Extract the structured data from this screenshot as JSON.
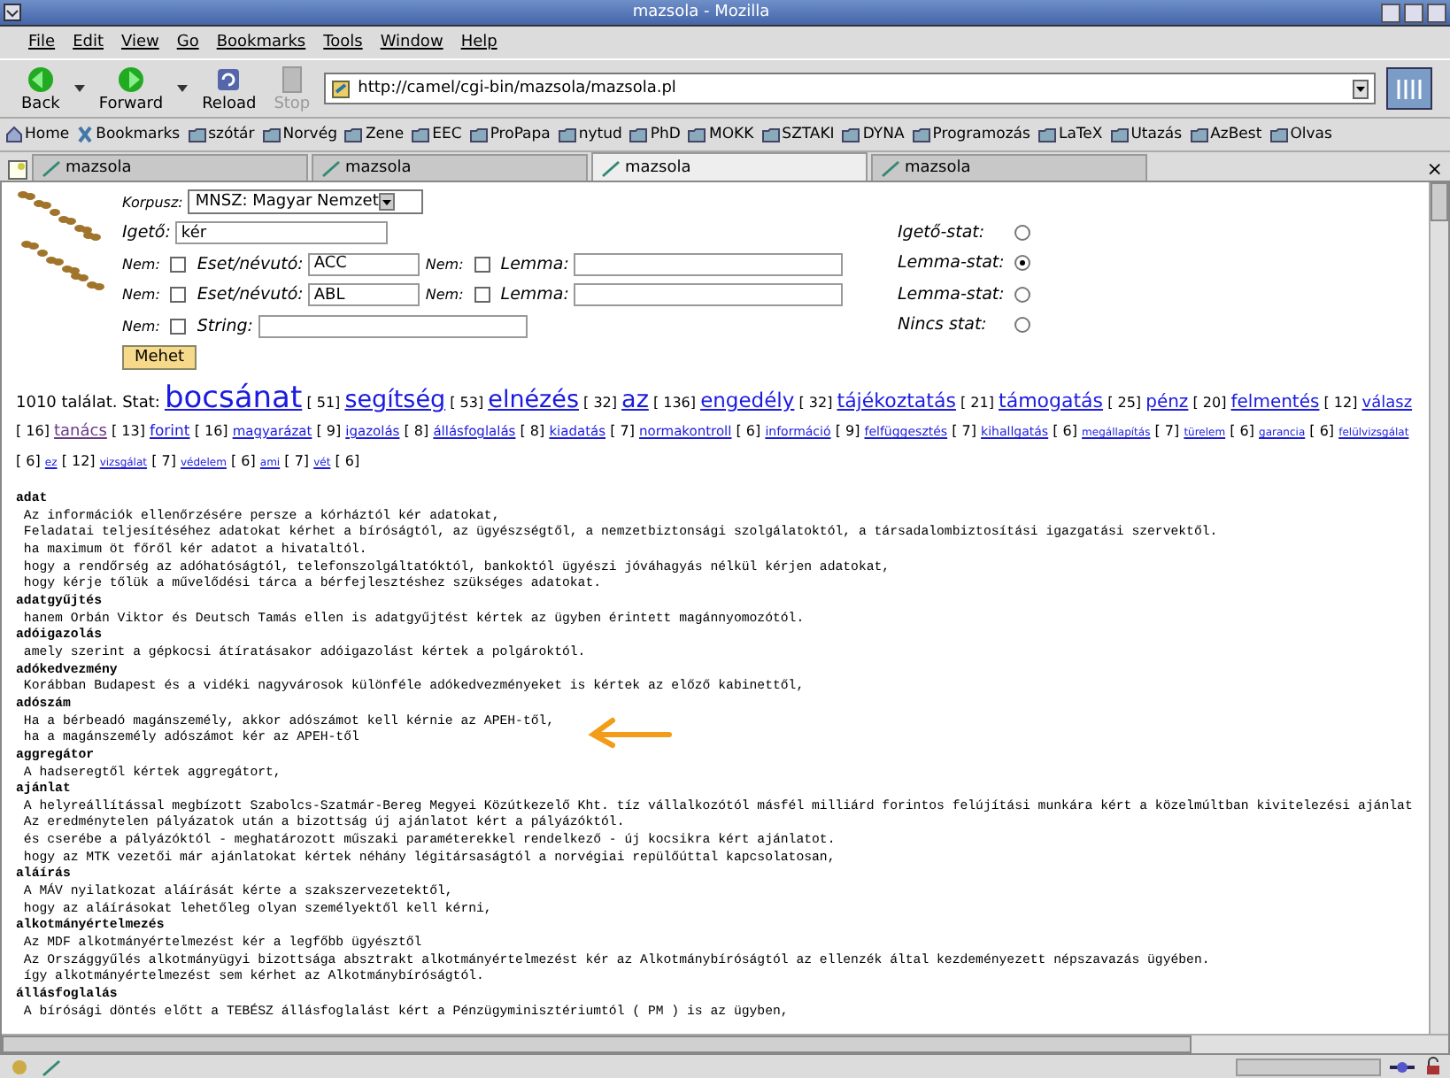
{
  "window": {
    "title": "mazsola - Mozilla"
  },
  "menu": [
    "File",
    "Edit",
    "View",
    "Go",
    "Bookmarks",
    "Tools",
    "Window",
    "Help"
  ],
  "nav_buttons": [
    {
      "kind": "back",
      "label": "Back",
      "disabled": false
    },
    {
      "kind": "forward",
      "label": "Forward",
      "disabled": false
    },
    {
      "kind": "reload",
      "label": "Reload",
      "disabled": false
    },
    {
      "kind": "stop",
      "label": "Stop",
      "disabled": true
    }
  ],
  "address": "http://camel/cgi-bin/mazsola/mazsola.pl",
  "bookmarks": [
    {
      "kind": "home",
      "label": "Home"
    },
    {
      "kind": "bookmarks",
      "label": "Bookmarks"
    },
    {
      "kind": "folder",
      "label": "szótár"
    },
    {
      "kind": "folder",
      "label": "Norvég"
    },
    {
      "kind": "folder",
      "label": "Zene"
    },
    {
      "kind": "folder",
      "label": "EEC"
    },
    {
      "kind": "folder",
      "label": "ProPapa"
    },
    {
      "kind": "folder",
      "label": "nytud"
    },
    {
      "kind": "folder",
      "label": "PhD"
    },
    {
      "kind": "folder",
      "label": "MOKK"
    },
    {
      "kind": "folder",
      "label": "SZTAKI"
    },
    {
      "kind": "folder",
      "label": "DYNA"
    },
    {
      "kind": "folder",
      "label": "Programozás"
    },
    {
      "kind": "folder",
      "label": "LaTeX"
    },
    {
      "kind": "folder",
      "label": "Utazás"
    },
    {
      "kind": "folder",
      "label": "AzBest"
    },
    {
      "kind": "folder",
      "label": "Olvas"
    }
  ],
  "tabs": [
    {
      "label": "mazsola",
      "selected": false
    },
    {
      "label": "mazsola",
      "selected": false
    },
    {
      "label": "mazsola",
      "selected": true
    },
    {
      "label": "mazsola",
      "selected": false
    }
  ],
  "close_tab": "×",
  "form": {
    "corpus": {
      "label": "Korpusz:",
      "value": "MNSZ: Magyar Nemzet"
    },
    "verb": {
      "label": "Igető:",
      "value": "kér"
    },
    "filters": [
      {
        "neg_label": "Nem:",
        "negated": false,
        "label": "Eset/névutó:",
        "value": "ACC",
        "lemma_neg_label": "Nem:",
        "lemma_negated": false,
        "lemma_label": "Lemma:"
      },
      {
        "neg_label": "Nem:",
        "negated": false,
        "label": "Eset/névutó:",
        "value": "ABL",
        "lemma_neg_label": "Nem:",
        "lemma_negated": false,
        "lemma_label": "Lemma:"
      }
    ],
    "string": {
      "neg_label": "Nem:",
      "negated": false,
      "label": "String:"
    },
    "stats": [
      {
        "label": "Igető-stat:",
        "selected": false
      },
      {
        "label": "Lemma-stat:",
        "selected": true
      },
      {
        "label": "Lemma-stat:",
        "selected": false
      },
      {
        "label": "Nincs stat:",
        "selected": false
      }
    ],
    "submit": "Mehet"
  },
  "results": {
    "summary": "1010 találat. Stat:",
    "stats": [
      {
        "word": "bocsánat",
        "count": "[ 51]",
        "visited": false
      },
      {
        "word": "segítség",
        "count": "[ 53]",
        "visited": false
      },
      {
        "word": "elnézés",
        "count": "[ 32]",
        "visited": false
      },
      {
        "word": "az",
        "count": "[ 136]",
        "visited": false
      },
      {
        "word": "engedély",
        "count": "[ 32]",
        "visited": false
      },
      {
        "word": "tájékoztatás",
        "count": "[ 21]",
        "visited": false
      },
      {
        "word": "támogatás",
        "count": "[ 25]",
        "visited": false
      },
      {
        "word": "pénz",
        "count": "[ 20]",
        "visited": false
      },
      {
        "word": "felmentés",
        "count": "[ 12]",
        "visited": false
      },
      {
        "word": "válasz",
        "count": "[ 16]",
        "visited": false
      },
      {
        "word": "tanács",
        "count": "[ 13]",
        "visited": true
      },
      {
        "word": "forint",
        "count": "[ 16]",
        "visited": false
      },
      {
        "word": "magyarázat",
        "count": "[ 9]",
        "visited": false
      },
      {
        "word": "igazolás",
        "count": "[ 8]",
        "visited": false
      },
      {
        "word": "állásfoglalás",
        "count": "[ 8]",
        "visited": false
      },
      {
        "word": "kiadatás",
        "count": "[ 7]",
        "visited": false
      },
      {
        "word": "normakontroll",
        "count": "[ 6]",
        "visited": false
      },
      {
        "word": "információ",
        "count": "[ 9]",
        "visited": false
      },
      {
        "word": "felfüggesztés",
        "count": "[ 7]",
        "visited": false
      },
      {
        "word": "kihallgatás",
        "count": "[ 6]",
        "visited": false
      },
      {
        "word": "megállapítás",
        "count": "[ 7]",
        "visited": false
      },
      {
        "word": "türelem",
        "count": "[ 6]",
        "visited": false
      },
      {
        "word": "garancia",
        "count": "[ 6]",
        "visited": false
      },
      {
        "word": "felülvizsgálat",
        "count": "[ 6]",
        "visited": false
      },
      {
        "word": "ez",
        "count": "[ 12]",
        "visited": false
      },
      {
        "word": "vizsgálat",
        "count": "[ 7]",
        "visited": false
      },
      {
        "word": "védelem",
        "count": "[ 6]",
        "visited": false
      },
      {
        "word": "ami",
        "count": "[ 7]",
        "visited": false
      },
      {
        "word": "vét",
        "count": "[ 6]",
        "visited": false
      }
    ],
    "entries": [
      {
        "head": "adat",
        "lines": [
          "Az információk ellenőrzésére persze a kórháztól kér adatokat,",
          "Feladatai teljesítéséhez adatokat kérhet a bíróságtól, az ügyészségtől, a nemzetbiztonsági szolgálatoktól, a társadalombiztosítási igazgatási szervektől.",
          "ha maximum öt főről kér adatot a hivataltól.",
          "hogy a rendőrség az adóhatóságtól, telefonszolgáltatóktól, bankoktól ügyészi jóváhagyás nélkül kérjen adatokat,",
          "hogy kérje tőlük a művelődési tárca a bérfejlesztéshez szükséges adatokat."
        ]
      },
      {
        "head": "adatgyűjtés",
        "lines": [
          "hanem Orbán Viktor és Deutsch Tamás ellen is adatgyűjtést kértek az ügyben érintett magánnyomozótól."
        ]
      },
      {
        "head": "adóigazolás",
        "lines": [
          "amely szerint a gépkocsi átíratásakor adóigazolást kértek a polgároktól."
        ]
      },
      {
        "head": "adókedvezmény",
        "lines": [
          "Korábban Budapest és a vidéki nagyvárosok különféle adókedvezményeket is kértek az előző kabinettől,"
        ]
      },
      {
        "head": "adószám",
        "lines": [
          "Ha a bérbeadó magánszemély, akkor adószámot kell kérnie az APEH-től,",
          "ha a magánszemély adószámot kér az APEH-től"
        ]
      },
      {
        "head": "aggregátor",
        "lines": [
          "A hadseregtől kértek aggregátort,"
        ]
      },
      {
        "head": "ajánlat",
        "lines": [
          "A helyreállítással megbízott Szabolcs-Szatmár-Bereg Megyei Közútkezelő Kht. tíz vállalkozótól másfél milliárd forintos felújítási munkára kért a közelmúltban kivitelezési ajánlat",
          "Az eredménytelen pályázatok után a bizottság új ajánlatot kért a pályázóktól.",
          "és cserébe a pályázóktól - meghatározott műszaki paraméterekkel rendelkező - új kocsikra kért ajánlatot.",
          "hogy az MTK vezetői már ajánlatokat kértek néhány légitársaságtól a norvégiai repülőúttal kapcsolatosan,"
        ]
      },
      {
        "head": "aláírás",
        "lines": [
          "A MÁV nyilatkozat aláírását kérte a szakszervezetektől,",
          "hogy az aláírásokat lehetőleg olyan személyektől kell kérni,"
        ]
      },
      {
        "head": "alkotmányértelmezés",
        "lines": [
          "Az MDF alkotmányértelmezést kér a legfőbb ügyésztől",
          "Az Országgyűlés alkotmányügyi bizottsága absztrakt alkotmányértelmezést kér az Alkotmánybíróságtól az ellenzék által kezdeményezett népszavazás ügyében.",
          "így alkotmányértelmezést sem kérhet az Alkotmánybíróságtól."
        ]
      },
      {
        "head": "állásfoglalás",
        "lines": [
          "A bírósági döntés előtt a TEBÉSZ állásfoglalást kért a Pénzügyminisztériumtól ( PM ) is az ügyben,"
        ]
      }
    ]
  }
}
